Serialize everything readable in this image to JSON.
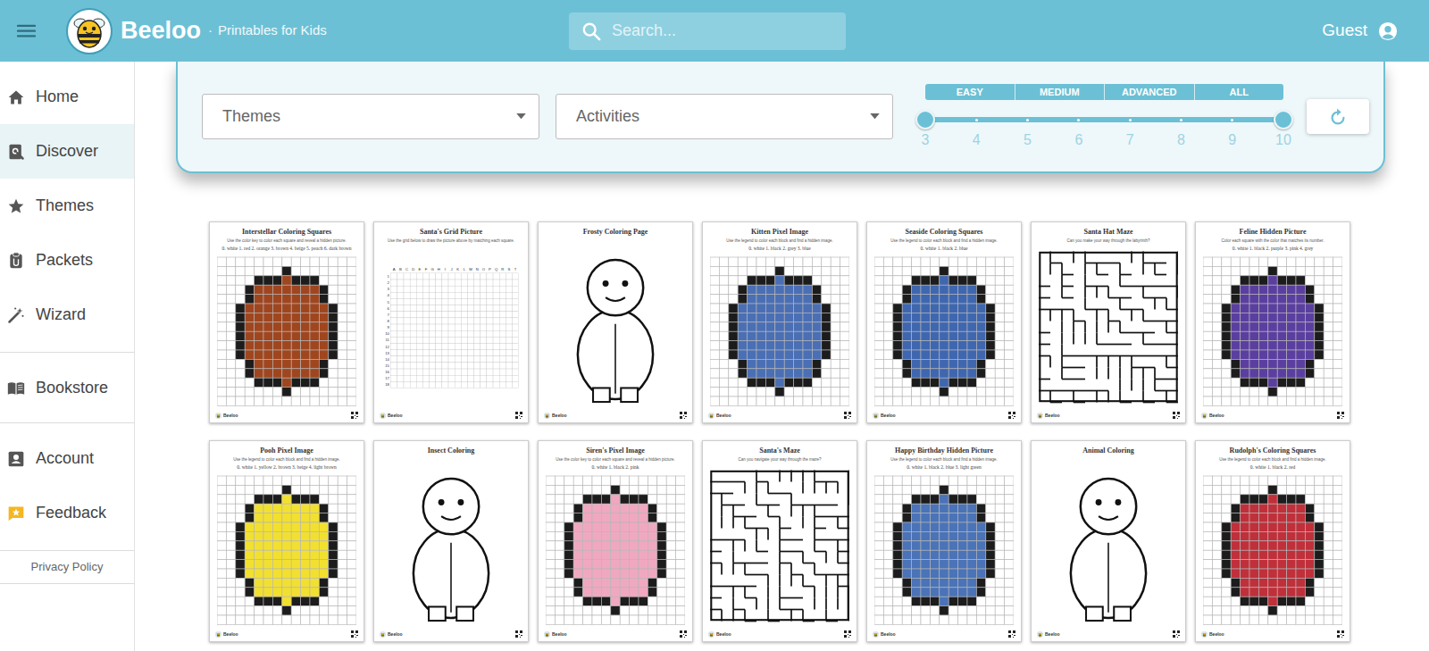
{
  "header": {
    "brand": "Beeloo",
    "separator": "·",
    "tagline": "Printables for Kids",
    "search": {
      "placeholder": "Search..."
    },
    "user": "Guest"
  },
  "sidebar": {
    "groups": [
      [
        {
          "label": "Home",
          "selected": false
        },
        {
          "label": "Discover",
          "selected": true
        },
        {
          "label": "Themes",
          "selected": false
        },
        {
          "label": "Packets",
          "selected": false
        },
        {
          "label": "Wizard",
          "selected": false
        }
      ],
      [
        {
          "label": "Bookstore",
          "selected": false
        }
      ],
      [
        {
          "label": "Account",
          "selected": false
        },
        {
          "label": "Feedback",
          "selected": false
        }
      ]
    ],
    "footer": "Privacy Policy"
  },
  "filters": {
    "themes": "Themes",
    "activities": "Activities",
    "difficulty": [
      "EASY",
      "MEDIUM",
      "ADVANCED",
      "ALL"
    ],
    "ages": [
      "3",
      "4",
      "5",
      "6",
      "7",
      "8",
      "9",
      "10"
    ],
    "range": {
      "low": 0,
      "high": 1
    }
  },
  "worksheets": [
    {
      "title": "Interstellar Coloring Squares",
      "subtitle": "Use the color key to color each square and reveal a hidden picture.",
      "legend": "0. white 1. red 2. orange 3. brown 4. beige 5. peach 6. dark brown",
      "kind": "pixel",
      "color": "#a0461f",
      "brand": "Beeloo"
    },
    {
      "title": "Santa's Grid Picture",
      "subtitle": "Use the grid below to draw the picture above by matching each square.",
      "legend": "",
      "kind": "grid",
      "brand": "Beeloo",
      "columns": [
        "A",
        "B",
        "C",
        "D",
        "E",
        "F",
        "G",
        "H",
        "I",
        "J",
        "K",
        "L",
        "M",
        "N",
        "O",
        "P",
        "Q",
        "R",
        "S",
        "T"
      ],
      "rows": [
        "1",
        "2",
        "3",
        "4",
        "5",
        "6",
        "7",
        "8",
        "9",
        "10",
        "11",
        "12",
        "13",
        "14",
        "15",
        "16",
        "17",
        "18"
      ]
    },
    {
      "title": "Frosty Coloring Page",
      "subtitle": "",
      "legend": "",
      "kind": "coloring",
      "brand": "Beeloo"
    },
    {
      "title": "Kitten Pixel Image",
      "subtitle": "Use the legend to color each block and find a hidden image.",
      "legend": "0. white 1. black 2. grey 3. blue",
      "kind": "pixel",
      "color": "#4a6fb5",
      "brand": "Beeloo"
    },
    {
      "title": "Seaside Coloring Squares",
      "subtitle": "Use the legend to color each block and find a hidden image.",
      "legend": "0. white 1. black 2. blue",
      "kind": "pixel",
      "color": "#3f67b0",
      "brand": "Beeloo"
    },
    {
      "title": "Santa Hat Maze",
      "subtitle": "Can you make your way through the labyrinth?",
      "legend": "",
      "kind": "maze",
      "brand": "Beeloo"
    },
    {
      "title": "Feline Hidden Picture",
      "subtitle": "Color each square with the color that matches its number.",
      "legend": "0. white 1. black 2. purple 3. pink 4. grey",
      "kind": "pixel",
      "color": "#5b3fa0",
      "brand": "Beeloo"
    },
    {
      "title": "Pooh Pixel Image",
      "subtitle": "Use the legend to color each block and find a hidden image.",
      "legend": "0. white 1. yellow 2. brown 3. beige 4. light brown",
      "kind": "pixel",
      "color": "#f2e030",
      "brand": "Beeloo"
    },
    {
      "title": "Insect Coloring",
      "subtitle": "",
      "legend": "",
      "kind": "coloring",
      "brand": "Beeloo"
    },
    {
      "title": "Siren's Pixel Image",
      "subtitle": "Use the color key to color each square and reveal a hidden picture.",
      "legend": "0. white 1. black 2. pink",
      "kind": "pixel",
      "color": "#f0a8c0",
      "brand": "Beeloo"
    },
    {
      "title": "Santa's Maze",
      "subtitle": "Can you navigate your way through the maze?",
      "legend": "",
      "kind": "maze",
      "brand": "Beeloo"
    },
    {
      "title": "Happy Birthday Hidden Picture",
      "subtitle": "Use the legend to color each block and find a hidden image.",
      "legend": "0. white 1. black 2. blue 3. light green",
      "kind": "pixel",
      "color": "#4a73b8",
      "brand": "Beeloo"
    },
    {
      "title": "Animal Coloring",
      "subtitle": "",
      "legend": "",
      "kind": "coloring",
      "brand": "Beeloo"
    },
    {
      "title": "Rudolph's Coloring Squares",
      "subtitle": "Use the legend to color each block and find a hidden image.",
      "legend": "0. white 1. black 2. red",
      "kind": "pixel",
      "color": "#c0303a",
      "brand": "Beeloo"
    }
  ]
}
